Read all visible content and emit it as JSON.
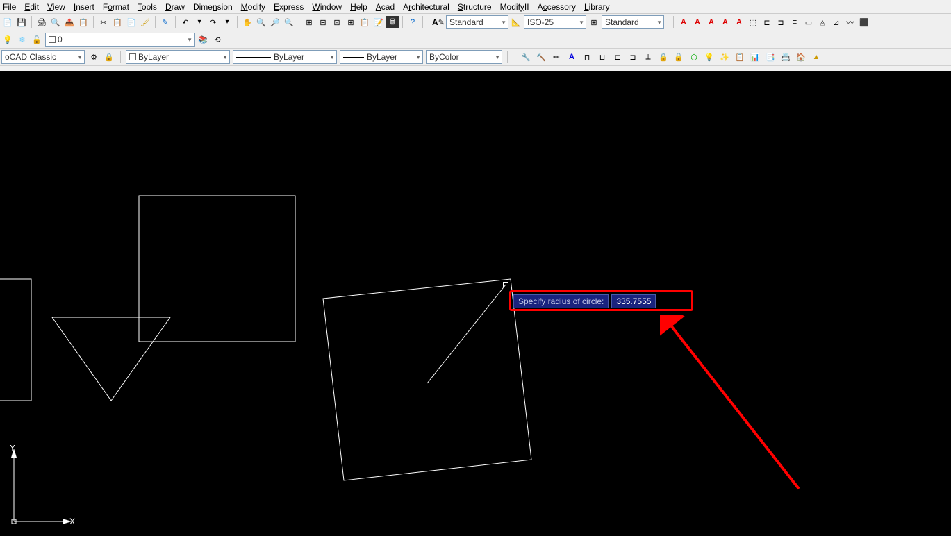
{
  "menu": {
    "file": "File",
    "edit": "Edit",
    "view": "View",
    "insert": "Insert",
    "format": "Format",
    "tools": "Tools",
    "draw": "Draw",
    "dimension": "Dimension",
    "modify": "Modify",
    "express": "Express",
    "window": "Window",
    "help": "Help",
    "acad": "Acad",
    "architectural": "Architectural",
    "structure": "Structure",
    "modify2": "ModifyII",
    "accessory": "Accessory",
    "library": "Library"
  },
  "text_style": {
    "value": "Standard"
  },
  "dim_style": {
    "value": "ISO-25"
  },
  "table_style": {
    "value": "Standard"
  },
  "layer": {
    "current": "0"
  },
  "workspace": {
    "value": "oCAD Classic"
  },
  "props": {
    "color": "ByLayer",
    "linetype": "ByLayer",
    "lineweight": "ByLayer",
    "plotstyle": "ByColor"
  },
  "dynamic_input": {
    "prompt": "Specify radius of circle:",
    "value": "335.7555"
  },
  "ucs": {
    "x": "X",
    "y": "Y"
  }
}
